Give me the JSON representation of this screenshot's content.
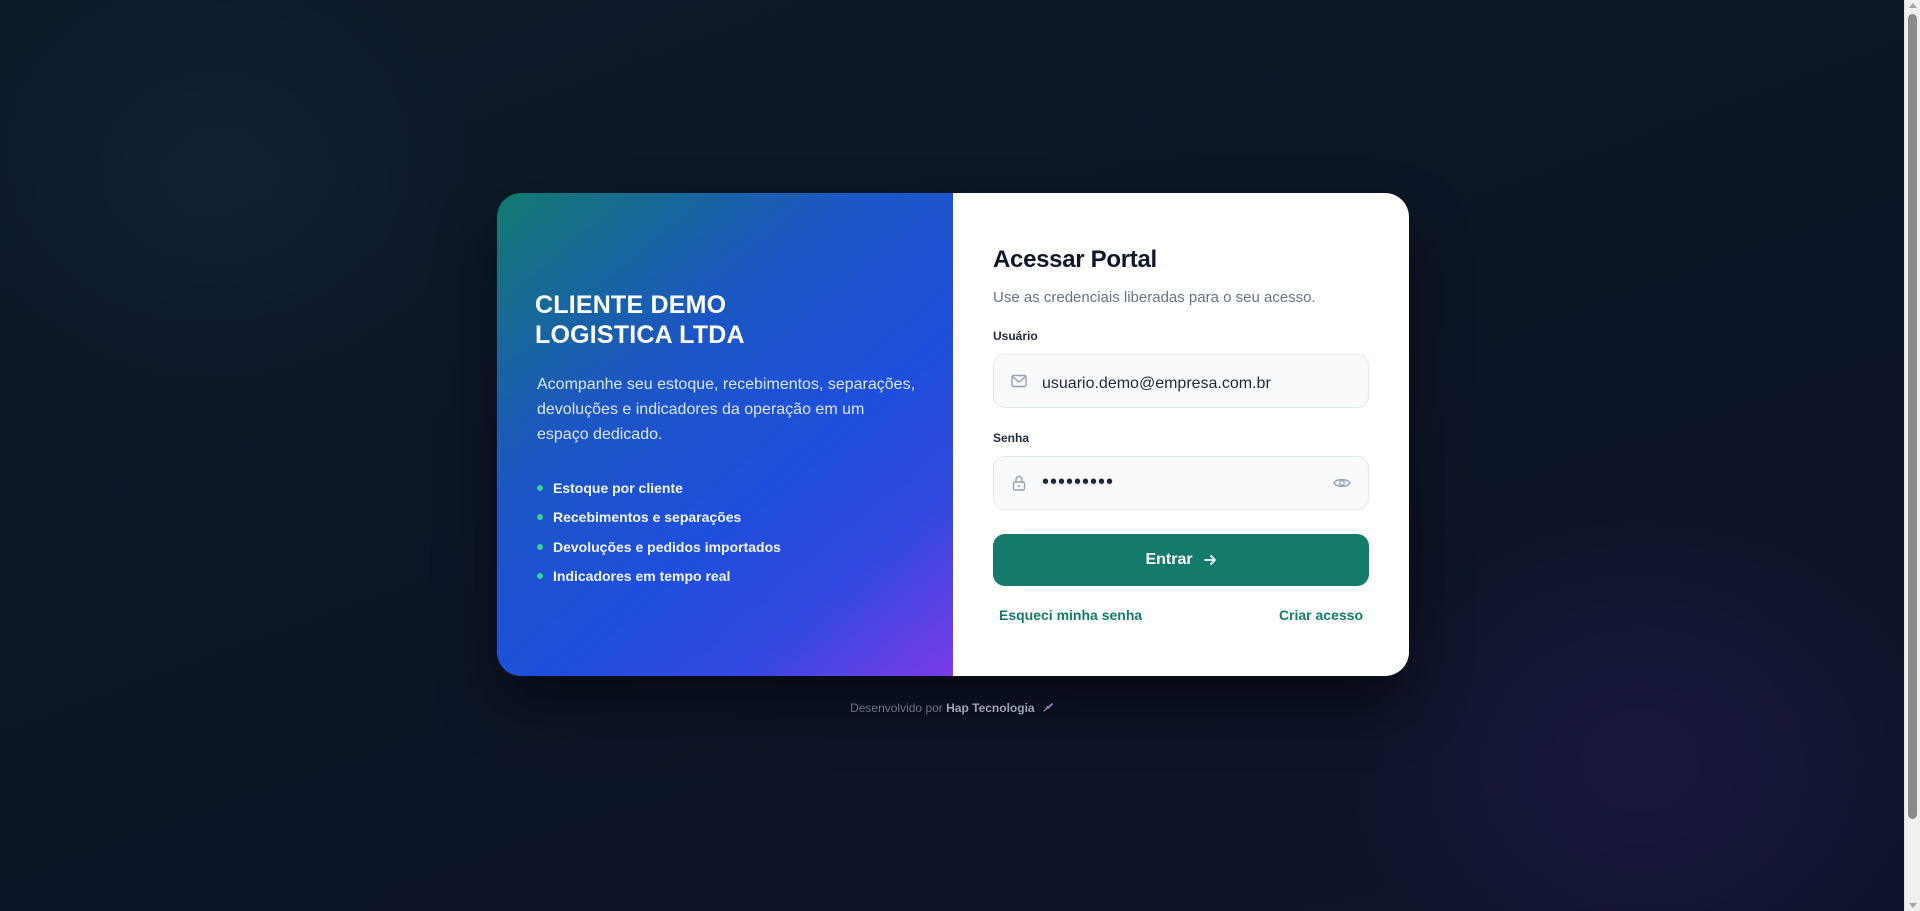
{
  "brand": {
    "title": "CLIENTE DEMO\nLOGISTICA LTDA",
    "description": "Acompanhe seu estoque, recebimentos, separações, devoluções e indicadores da operação em um espaço dedicado.",
    "features": [
      "Estoque por cliente",
      "Recebimentos e separações",
      "Devoluções e pedidos importados",
      "Indicadores em tempo real"
    ]
  },
  "login": {
    "title": "Acessar Portal",
    "subtitle": "Use as credenciais liberadas para o seu acesso.",
    "username_label": "Usuário",
    "username_value": "usuario.demo@empresa.com.br",
    "password_label": "Senha",
    "password_value": "123456789",
    "submit_label": "Entrar",
    "forgot_label": "Esqueci minha senha",
    "create_label": "Criar acesso"
  },
  "footer": {
    "prefix": "Desenvolvido por",
    "brand": "Hap Tecnologia"
  },
  "icons": {
    "username": "mail-icon",
    "password": "lock-icon",
    "toggle": "eye-icon",
    "submit": "arrow-right-icon",
    "footer": "rocket-icon"
  },
  "colors": {
    "accent": "#137a6c",
    "bullet": "#34d399",
    "gradient_start": "#127a6e",
    "gradient_mid": "#1e4fdc",
    "gradient_end": "#7b3be8"
  }
}
